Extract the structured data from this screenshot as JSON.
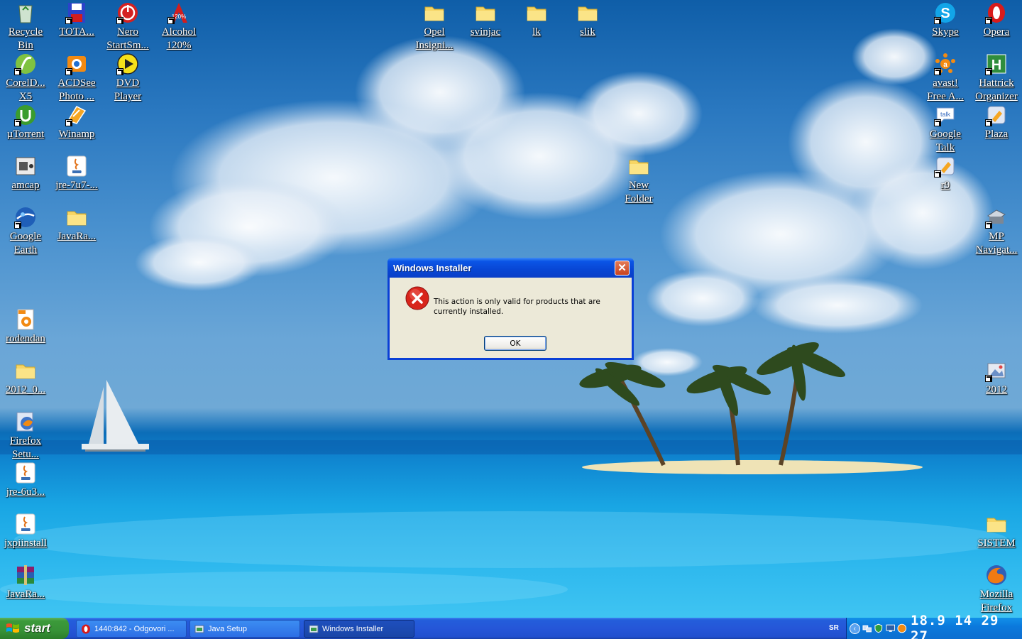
{
  "desktop": {
    "icons_left": [
      {
        "label": "Recycle\nBin",
        "icon": "recycle-bin-icon"
      },
      {
        "label": "TOTA...",
        "icon": "floppy-icon"
      },
      {
        "label": "Nero\nStartSm...",
        "icon": "nero-icon"
      },
      {
        "label": "Alcohol\n120%",
        "icon": "alcohol-icon"
      },
      {
        "label": "CorelD...\nX5",
        "icon": "corel-icon"
      },
      {
        "label": "ACDSee\nPhoto ...",
        "icon": "acdsee-icon"
      },
      {
        "label": "DVD\nPlayer",
        "icon": "dvd-player-icon"
      },
      {
        "label": "µTorrent",
        "icon": "utorrent-icon"
      },
      {
        "label": "Winamp",
        "icon": "winamp-icon"
      },
      {
        "label": "amcap",
        "icon": "amcap-icon"
      },
      {
        "label": "jre-7u7-...",
        "icon": "java-icon"
      },
      {
        "label": "Google\nEarth",
        "icon": "google-earth-icon"
      },
      {
        "label": "JavaRa...",
        "icon": "folder-icon"
      },
      {
        "label": "rodendan",
        "icon": "jpg-file-icon"
      },
      {
        "label": "2012_0...",
        "icon": "folder-icon"
      },
      {
        "label": "Firefox\nSetu...",
        "icon": "firefox-setup-icon"
      },
      {
        "label": "jre-6u3...",
        "icon": "java-icon"
      },
      {
        "label": "jxpiinstall",
        "icon": "java-icon"
      },
      {
        "label": "JavaRa...",
        "icon": "winrar-icon"
      }
    ],
    "icons_top": [
      {
        "label": "Opel\nInsigni...",
        "icon": "folder-icon"
      },
      {
        "label": "svinjac",
        "icon": "folder-icon"
      },
      {
        "label": "lk",
        "icon": "folder-icon"
      },
      {
        "label": "slik",
        "icon": "folder-icon"
      },
      {
        "label": "New\nFolder",
        "icon": "folder-icon"
      }
    ],
    "icons_right": [
      {
        "label": "Skype",
        "icon": "skype-icon"
      },
      {
        "label": "Opera",
        "icon": "opera-icon"
      },
      {
        "label": "avast!\nFree A...",
        "icon": "avast-icon"
      },
      {
        "label": "Hattrick\nOrganizer",
        "icon": "hattrick-icon"
      },
      {
        "label": "Google\nTalk",
        "icon": "google-talk-icon"
      },
      {
        "label": "Plaza",
        "icon": "plaza-icon"
      },
      {
        "label": "r9",
        "icon": "plaza-icon"
      },
      {
        "label": "MP\nNavigat...",
        "icon": "mp-navigator-icon"
      },
      {
        "label": "2012",
        "icon": "image-folder-icon"
      },
      {
        "label": "SISTEM",
        "icon": "folder-icon"
      },
      {
        "label": "Mozilla\nFirefox",
        "icon": "firefox-icon"
      }
    ]
  },
  "dialog": {
    "title": "Windows Installer",
    "close_label": "✕",
    "message": "This action is only valid for products that are currently installed.",
    "ok_label": "OK"
  },
  "taskbar": {
    "start_label": "start",
    "tasks": [
      {
        "label": "1440:842 - Odgovori ...",
        "icon": "opera-icon",
        "active": false
      },
      {
        "label": "Java Setup",
        "icon": "installer-icon",
        "active": false
      },
      {
        "label": "Windows Installer",
        "icon": "installer-icon",
        "active": true
      }
    ],
    "language": "SR",
    "clock": "18.9 14 29 27"
  },
  "colors": {
    "taskbar_blue": "#245edb",
    "start_green": "#3c9a3a",
    "dialog_face": "#ece9d8",
    "title_blue": "#0846d4",
    "error_red": "#d8251b"
  }
}
